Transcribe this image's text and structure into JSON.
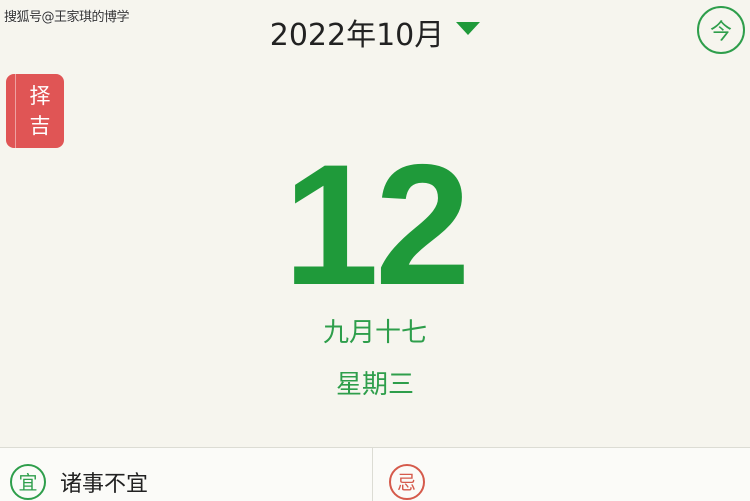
{
  "watermark": "搜狐号@王家琪的博学",
  "header": {
    "month_title": "2022年10月",
    "today_label": "今"
  },
  "zeji": {
    "chars": [
      "择",
      "吉"
    ]
  },
  "day": {
    "number": "12",
    "lunar": "九月十七",
    "weekday": "星期三"
  },
  "almanac": {
    "yi_label": "宜",
    "yi_text": "诸事不宜",
    "ji_label": "忌"
  },
  "colors": {
    "accent_green": "#1f9a3a",
    "tag_red": "#e05555",
    "ji_red": "#d55a4b",
    "background": "#f6f5ee"
  }
}
